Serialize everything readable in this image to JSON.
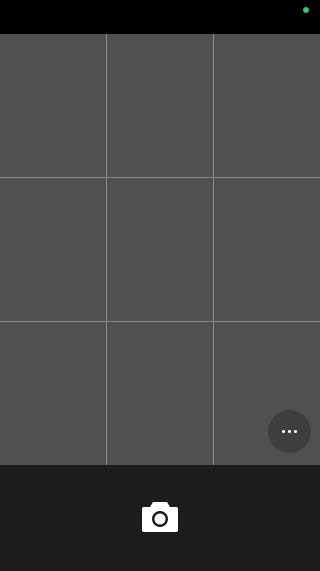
{
  "status_bar": {
    "indicator_color": "#2ecc71"
  },
  "viewfinder": {
    "grid": "3x3",
    "background_color": "#505050"
  },
  "controls": {
    "more_icon": "more-horizontal-icon",
    "shutter_icon": "camera-icon"
  },
  "colors": {
    "bottom_bar": "#1c1c1c",
    "icon": "#ffffff"
  }
}
